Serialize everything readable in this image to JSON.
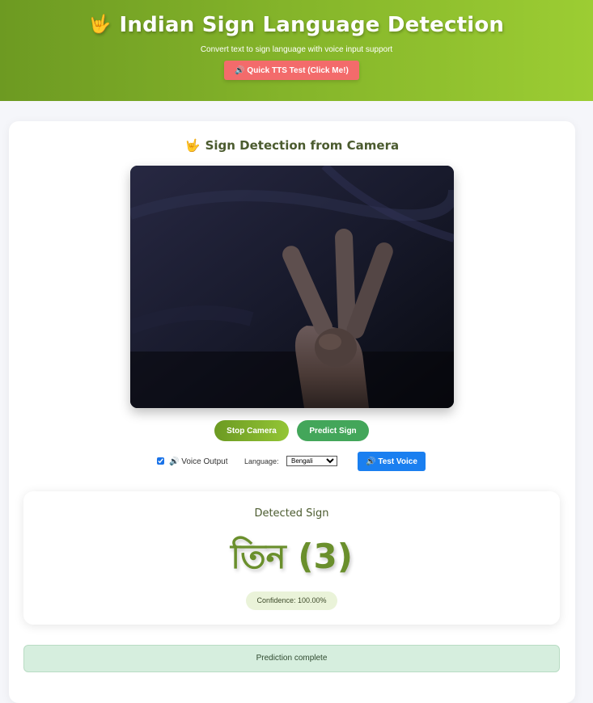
{
  "header": {
    "emoji": "🤟",
    "title": "Indian Sign Language Detection",
    "subtitle": "Convert text to sign language with voice input support",
    "tts_button": "🔊 Quick TTS Test (Click Me!)"
  },
  "camera": {
    "emoji": "🤟",
    "title": "Sign Detection from Camera",
    "stop_button": "Stop Camera",
    "predict_button": "Predict Sign"
  },
  "controls": {
    "voice_output_checked": true,
    "voice_output_label": "🔊 Voice Output",
    "language_label": "Language:",
    "language_selected": "Bengali",
    "test_voice_button": "🔊 Test Voice"
  },
  "result": {
    "title": "Detected Sign",
    "sign": "তিন (3)",
    "confidence": "Confidence: 100.00%"
  },
  "status": {
    "message": "Prediction complete"
  },
  "colors": {
    "header_gradient_start": "#6d9a22",
    "header_gradient_end": "#9ccd33",
    "tts_button": "#f36b6b",
    "predict_button": "#43a65a",
    "test_voice_button": "#1a7ff0",
    "result_text": "#6a8f2c",
    "status_background": "#d6eede"
  }
}
